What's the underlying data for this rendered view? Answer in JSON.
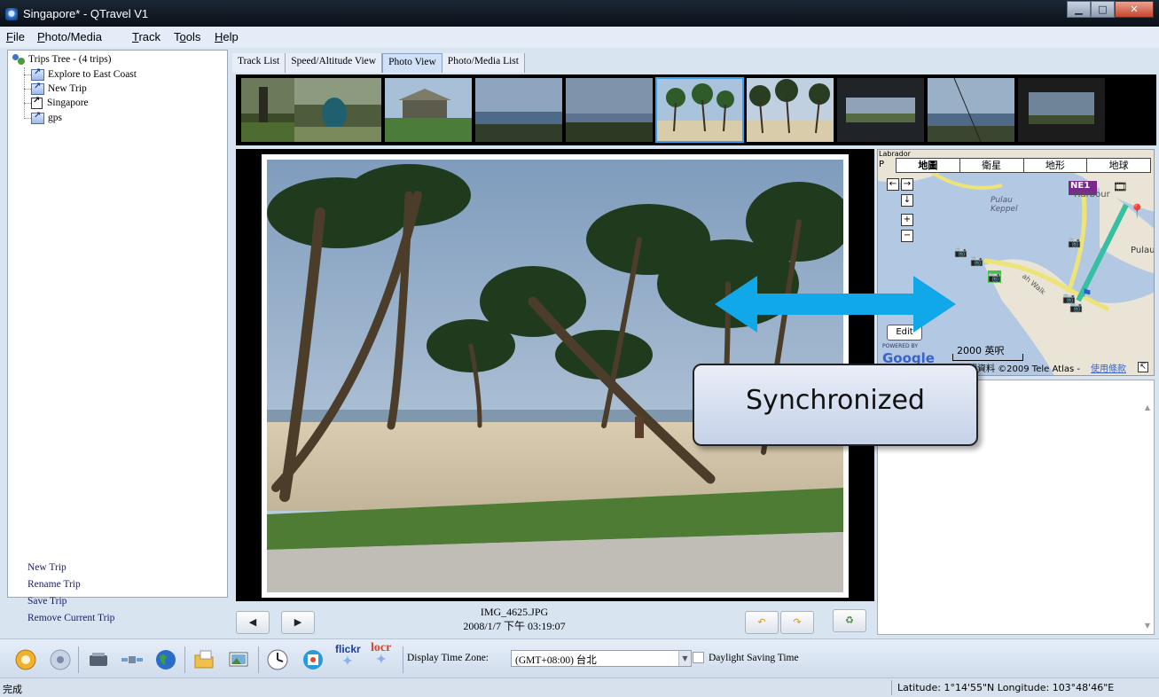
{
  "window": {
    "title": "Singapore* - QTravel V1",
    "controls": [
      "minimize",
      "maximize",
      "close"
    ]
  },
  "menu": {
    "items": [
      {
        "label": "File",
        "accel": "F",
        "rest": "ile"
      },
      {
        "label": "Photo/Media",
        "accel": "P",
        "rest": "hoto/Media"
      },
      {
        "label": "Track",
        "accel": "T",
        "rest": "rack"
      },
      {
        "label": "Tools",
        "accel_pre": "T",
        "accel": "o",
        "rest": "ols"
      },
      {
        "label": "Help",
        "accel": "H",
        "rest": "elp"
      }
    ]
  },
  "tree": {
    "root": "Trips Tree -  (4 trips)",
    "trips": [
      "Explore to East Coast",
      "New Trip",
      "Singapore",
      "gps"
    ]
  },
  "trip_actions": [
    "New Trip",
    "Rename Trip",
    "Save Trip",
    "Remove Current Trip"
  ],
  "view_tabs": [
    {
      "label": "Track List",
      "active": false
    },
    {
      "label": "Speed/Altitude View",
      "active": false
    },
    {
      "label": "Photo View",
      "active": true
    },
    {
      "label": "Photo/Media List",
      "active": false
    }
  ],
  "filmstrip": {
    "count": 10,
    "selected_index": 5
  },
  "photo": {
    "filename": "IMG_4625.JPG",
    "datetime": "2008/1/7 下午 03:19:07"
  },
  "map": {
    "type_tabs": [
      "地圖",
      "衛星",
      "地形",
      "地球"
    ],
    "active_type": "地圖",
    "labels": {
      "labrador": "Labrador",
      "p": "P",
      "harbour": "Harbour",
      "pulau_keppel": "Pulau\nKeppel",
      "pulau": "Pulau",
      "station": "NE1",
      "walk": "ah Walk",
      "edit": "Edit",
      "scale": "2000 英呎",
      "powered_by": "POWERED BY",
      "google": "Google",
      "copyright": "地圖資料 ©2009 Tele Atlas - ",
      "terms": "使用條款"
    }
  },
  "callout": {
    "text": "Synchronized"
  },
  "toolbar": {
    "time_zone_label": "Display Time Zone:",
    "time_zone_value": "(GMT+08:00) 台北",
    "dst_label": "Daylight Saving Time",
    "dst_checked": false,
    "flickr_label": "flickr",
    "locr_label": "locr"
  },
  "status": {
    "left": "完成",
    "right": "Latitude: 1°14'55\"N  Longitude: 103°48'46\"E"
  },
  "colors": {
    "accent": "#3aa0f0",
    "callout_bg": "#d5ddef",
    "arrow": "#10a8e8"
  }
}
